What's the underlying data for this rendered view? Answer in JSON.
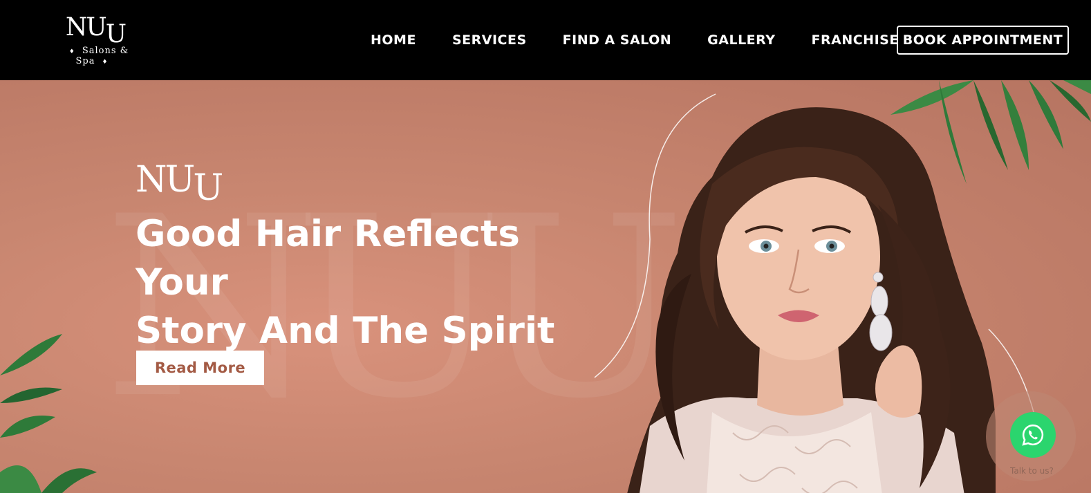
{
  "brand": {
    "mark": "NUU",
    "mark_first": "N",
    "mark_u1": "U",
    "mark_u2": "U",
    "tagline": "Salons & Spa",
    "diamond": "♦"
  },
  "nav": {
    "items": [
      {
        "label": "HOME"
      },
      {
        "label": "SERVICES"
      },
      {
        "label": "FIND A SALON"
      },
      {
        "label": "GALLERY"
      },
      {
        "label": "FRANCHISE"
      }
    ],
    "cta_label": "BOOK APPOINTMENT"
  },
  "hero": {
    "headline_line1": "Good Hair Reflects Your",
    "headline_line2": "Story And The Spirit",
    "button_label": "Read More",
    "watermark": "NUU"
  },
  "chat": {
    "icon": "whatsapp-icon",
    "label": "Talk to us?"
  },
  "colors": {
    "header_bg": "#000000",
    "hero_bg": "#c88670",
    "button_text": "#a35a44",
    "whatsapp": "#2bd56e"
  }
}
